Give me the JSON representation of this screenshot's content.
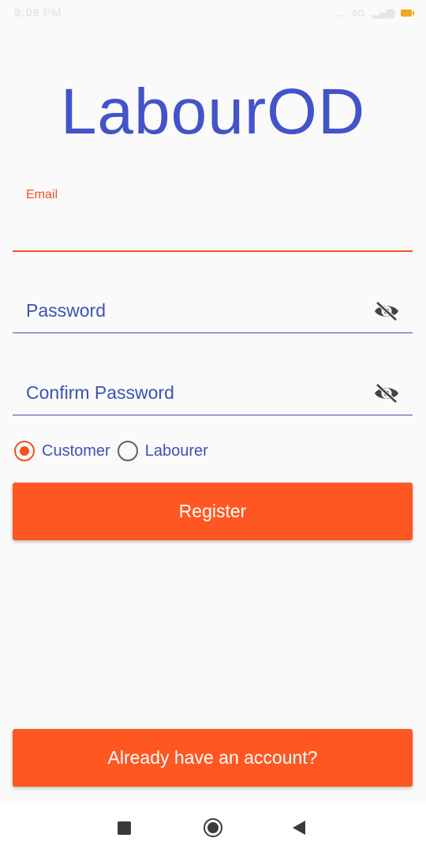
{
  "status_bar": {
    "time": "9:09 PM",
    "signal": "....",
    "network": "4G"
  },
  "app_title": "LabourOD",
  "email_field": {
    "label": "Email",
    "value": ""
  },
  "password_field": {
    "placeholder": "Password",
    "icon": "eye-off-icon"
  },
  "confirm_password_field": {
    "placeholder": "Confirm Password",
    "icon": "eye-off-icon"
  },
  "role_options": [
    {
      "label": "Customer",
      "selected": true
    },
    {
      "label": "Labourer",
      "selected": false
    }
  ],
  "register_button": "Register",
  "login_link_button": "Already have an account?",
  "colors": {
    "primary": "#3f51b5",
    "accent": "#ff5722",
    "background": "#fafafa"
  }
}
